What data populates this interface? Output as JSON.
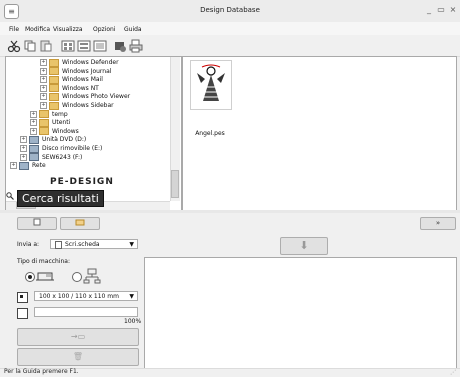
{
  "window": {
    "title": "Design Database",
    "minimize": "_",
    "maximize": "▭",
    "close": "×"
  },
  "menu": [
    "File",
    "Modifica",
    "Visualizza",
    "Opzioni",
    "Guida"
  ],
  "tree": [
    {
      "label": "Windows Defender",
      "indent": 4
    },
    {
      "label": "Windows Journal",
      "indent": 4
    },
    {
      "label": "Windows Mail",
      "indent": 4
    },
    {
      "label": "Windows NT",
      "indent": 4
    },
    {
      "label": "Windows Photo Viewer",
      "indent": 4
    },
    {
      "label": "Windows Sidebar",
      "indent": 4
    },
    {
      "label": "temp",
      "indent": 3
    },
    {
      "label": "Utenti",
      "indent": 3
    },
    {
      "label": "Windows",
      "indent": 3
    },
    {
      "label": "Unità DVD (D:)",
      "indent": 2
    },
    {
      "label": "Disco rimovibile (E:)",
      "indent": 2
    },
    {
      "label": "SEW6243 (F:)",
      "indent": 2
    },
    {
      "label": "Rete",
      "indent": 1
    }
  ],
  "tree_ghost": "PE-DESIGN",
  "tooltip": "Cerca risultati",
  "file": {
    "name": "Angel.pes"
  },
  "lower": {
    "send_to_label": "Invia a:",
    "send_to_value": "Scri.scheda",
    "machine_type_label": "Tipo di macchina:",
    "hoop_value": "100 x 100 / 110 x 110 mm",
    "progress_label": "100%",
    "progress": 0
  },
  "status": "Per la Guida premere F1."
}
